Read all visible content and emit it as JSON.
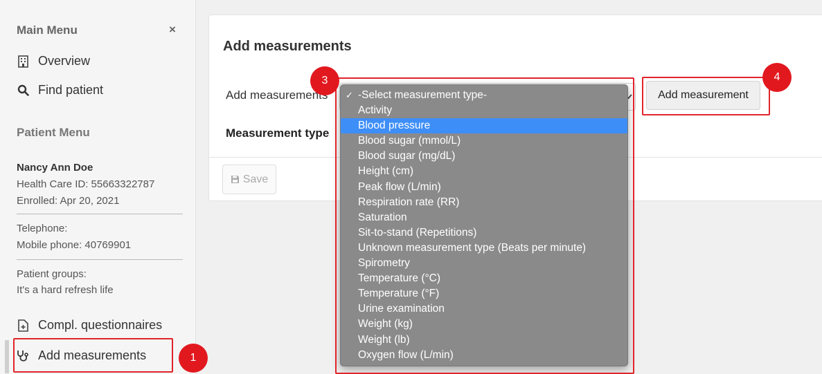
{
  "sidebar": {
    "main_menu": "Main Menu",
    "close": "×",
    "nav": {
      "overview": "Overview",
      "find_patient": "Find patient"
    },
    "patient_menu": "Patient Menu",
    "patient": {
      "name": "Nancy Ann Doe",
      "health_care_id": "Health Care ID: 55663322787",
      "enrolled": "Enrolled: Apr 20, 2021",
      "telephone": "Telephone:",
      "mobile": "Mobile phone: 40769901",
      "groups_label": "Patient groups:",
      "groups_value": "It's a hard refresh life"
    },
    "compl_questionnaires": "Compl. questionnaires",
    "add_measurements": "Add measurements"
  },
  "badges": {
    "one": "1",
    "three": "3",
    "four": "4"
  },
  "main": {
    "title": "Add measurements",
    "add_label": "Add measurements",
    "type_label": "Measurement type",
    "add_button": "Add measurement",
    "save_button": "Save"
  },
  "dropdown": {
    "check": "✓",
    "options": [
      "-Select measurement type-",
      "Activity",
      "Blood pressure",
      "Blood sugar (mmol/L)",
      "Blood sugar (mg/dL)",
      "Height (cm)",
      "Peak flow (L/min)",
      "Respiration rate (RR)",
      "Saturation",
      "Sit-to-stand (Repetitions)",
      "Unknown measurement type (Beats per minute)",
      "Spirometry",
      "Temperature (°C)",
      "Temperature (°F)",
      "Urine examination",
      "Weight (kg)",
      "Weight (lb)",
      "Oxygen flow (L/min)"
    ]
  },
  "colors": {
    "highlight_red": "#e0242a",
    "badge_red": "#e2181f",
    "selected_option": "#3e8ef7",
    "dropdown_bg": "#8a8a8a"
  }
}
